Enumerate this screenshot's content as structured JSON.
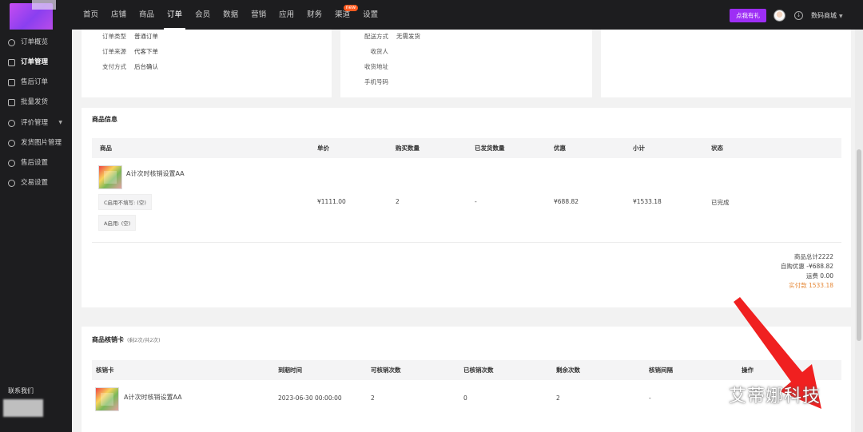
{
  "nav": {
    "items": [
      "首页",
      "店铺",
      "商品",
      "订单",
      "会员",
      "数据",
      "营销",
      "应用",
      "财务",
      "渠道",
      "设置"
    ],
    "active": "订单",
    "new_badge": "new",
    "gift_button": "点我有礼",
    "store_name": "数码商城"
  },
  "sidebar": {
    "items": [
      "订单概览",
      "订单管理",
      "售后订单",
      "批量发货",
      "评价管理",
      "发货图片管理",
      "售后设置",
      "交易设置"
    ],
    "active": "订单管理",
    "contact": "联系我们"
  },
  "order_info": {
    "left": [
      {
        "k": "订单类型",
        "v": "普通订单"
      },
      {
        "k": "订单来源",
        "v": "代客下单"
      },
      {
        "k": "支付方式",
        "v": "后台确认"
      }
    ],
    "right": [
      {
        "k": "配送方式",
        "v": "无需发货"
      },
      {
        "k": "收货人",
        "v": ""
      },
      {
        "k": "收货地址",
        "v": ""
      },
      {
        "k": "手机号码",
        "v": ""
      }
    ]
  },
  "goods": {
    "title": "商品信息",
    "headers": [
      "商品",
      "单价",
      "购买数量",
      "已发货数量",
      "优惠",
      "小计",
      "状态"
    ],
    "row": {
      "name": "A计次时核销设置AA",
      "tag1": "C启用不填写: (空)",
      "tag2": "A启用: (空)",
      "price": "¥1111.00",
      "qty": "2",
      "shipped": "-",
      "discount": "¥688.82",
      "subtotal": "¥1533.18",
      "status": "已完成"
    },
    "summary": {
      "total": "商品总计2222",
      "self_discount": "自购优惠 -¥688.82",
      "freight": "运费 0.00",
      "paid": "实付款 1533.18"
    }
  },
  "cards": {
    "title": "商品核销卡",
    "sub": "(剩2次/共2次)",
    "headers": [
      "核销卡",
      "到期时间",
      "可核销次数",
      "已核销次数",
      "剩余次数",
      "核销间隔",
      "操作"
    ],
    "row": {
      "name": "A计次时核销设置AA",
      "expire": "2023-06-30 00:00:00",
      "available": "2",
      "used": "0",
      "remain": "2",
      "interval": "-"
    }
  },
  "watermark": "艾蒂娜科技",
  "colors": {
    "accent": "#9d2ef5",
    "paid": "#e68a3a",
    "arrow": "#f02020"
  }
}
